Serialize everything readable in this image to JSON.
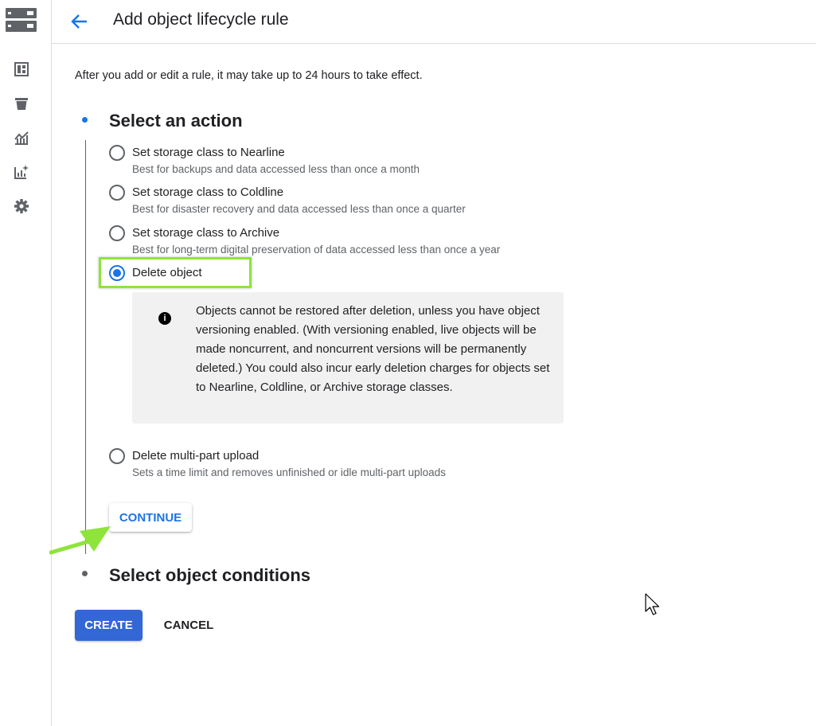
{
  "page": {
    "title": "Add object lifecycle rule",
    "notice": "After you add or edit a rule, it may take up to 24 hours to take effect."
  },
  "rail": {
    "icons": [
      "dashboard-icon",
      "bucket-icon",
      "monitoring-icon",
      "insights-icon",
      "settings-icon"
    ]
  },
  "steps": [
    {
      "title": "Select an action",
      "active": true,
      "options": [
        {
          "label": "Set storage class to Nearline",
          "description": "Best for backups and data accessed less than once a month",
          "selected": false
        },
        {
          "label": "Set storage class to Coldline",
          "description": "Best for disaster recovery and data accessed less than once a quarter",
          "selected": false
        },
        {
          "label": "Set storage class to Archive",
          "description": "Best for long-term digital preservation of data accessed less than once a year",
          "selected": false
        },
        {
          "label": "Delete object",
          "description": "",
          "selected": true
        },
        {
          "label": "Delete multi-part upload",
          "description": "Sets a time limit and removes unfinished or idle multi-part uploads",
          "selected": false
        }
      ],
      "info": "Objects cannot be restored after deletion, unless you have object versioning enabled. (With versioning enabled, live objects will be made noncurrent, and noncurrent versions will be permanently deleted.) You could also incur early deletion charges for objects set to Nearline, Coldline, or Archive storage classes.",
      "continue_label": "CONTINUE"
    },
    {
      "title": "Select object conditions",
      "active": false
    }
  ],
  "actions": {
    "create_label": "CREATE",
    "cancel_label": "CANCEL"
  },
  "colors": {
    "accent": "#1a73e8",
    "primary_button": "#3367d6",
    "annotation": "#8ee43b"
  }
}
